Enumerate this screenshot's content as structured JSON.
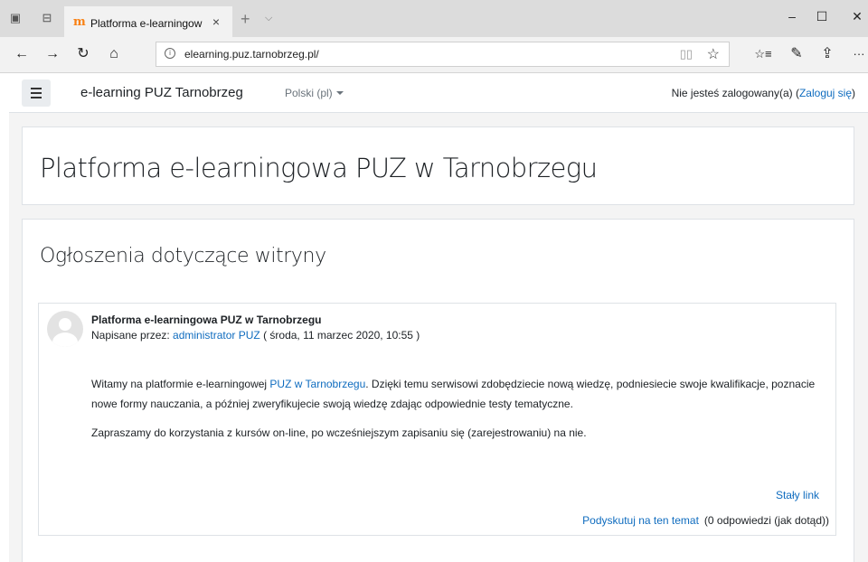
{
  "browser": {
    "tab_title": "Platforma e-learningow",
    "tab_favicon": "moodle-m-icon",
    "url": "elearning.puz.tarnobrzeg.pl/",
    "icons": {
      "close_tab": "×",
      "new_tab": "+",
      "tab_menu": "⌵",
      "minimize": "–",
      "maximize": "☐",
      "close_window": "✕",
      "back": "←",
      "forward": "→",
      "refresh": "↻",
      "home": "⌂",
      "reading_view": "📖",
      "favorite": "☆",
      "favorites_list": "☆≡",
      "notes": "✎",
      "share": "⇪",
      "more": "···",
      "info": "i"
    }
  },
  "navbar": {
    "brand": "e-learning PUZ Tarnobrzeg",
    "language": "Polski (pl)",
    "login_prefix": "Nie jesteś zalogowany(a) (",
    "login_link": "Zaloguj się",
    "login_suffix": ")"
  },
  "page": {
    "title": "Platforma e-learningowa PUZ w Tarnobrzegu",
    "section_title": "Ogłoszenia dotyczące witryny"
  },
  "post": {
    "title": "Platforma e-learningowa PUZ w Tarnobrzegu",
    "by_prefix": "Napisane przez: ",
    "author": "administrator PUZ",
    "date": " ( środa, 11 marzec 2020, 10:55 )",
    "p1_before": "Witamy na platformie e-learningowej ",
    "p1_link": "PUZ w Tarnobrzegu",
    "p1_after": ". Dzięki temu serwisowi zdobędziecie nową wiedzę, podniesiecie swoje kwalifikacje, poznacie nowe formy nauczania, a później zweryfikujecie swoją wiedzę zdając odpowiednie testy tematyczne.",
    "p2": "Zapraszamy do korzystania z kursów on-line, po wcześniejszym zapisaniu się (zarejestrowaniu) na nie.",
    "permalink": "Stały link",
    "discuss_link": "Podyskutuj na ten temat",
    "discuss_count": "(0 odpowiedzi (jak dotąd))"
  }
}
